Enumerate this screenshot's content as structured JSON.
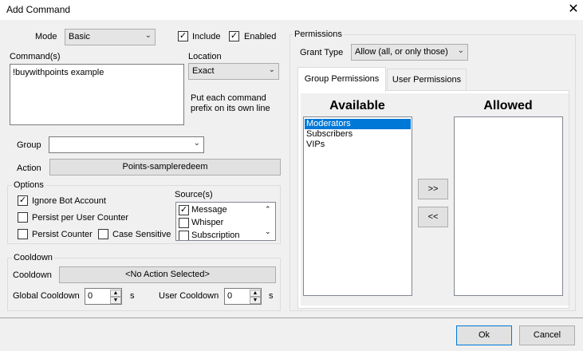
{
  "window": {
    "title": "Add Command",
    "close": "✕"
  },
  "mode": {
    "label": "Mode",
    "value": "Basic"
  },
  "include": {
    "label": "Include",
    "checked": true
  },
  "enabled": {
    "label": "Enabled",
    "checked": true
  },
  "commands": {
    "label": "Command(s)",
    "value": "!buywithpoints example"
  },
  "location": {
    "label": "Location",
    "value": "Exact",
    "hint_line1": "Put each command",
    "hint_line2": "prefix on its own line"
  },
  "group": {
    "label": "Group",
    "value": ""
  },
  "action": {
    "label": "Action",
    "value": "Points-sampleredeem"
  },
  "options": {
    "label": "Options",
    "ignore_bot": {
      "label": "Ignore Bot Account",
      "checked": true
    },
    "persist_user": {
      "label": "Persist per User Counter",
      "checked": false
    },
    "persist_counter": {
      "label": "Persist Counter",
      "checked": false
    },
    "case_sensitive": {
      "label": "Case Sensitive",
      "checked": false
    },
    "sources": {
      "label": "Source(s)",
      "items": [
        {
          "label": "Message",
          "checked": true
        },
        {
          "label": "Whisper",
          "checked": false
        },
        {
          "label": "Subscription",
          "checked": false
        }
      ]
    }
  },
  "cooldown": {
    "group_label": "Cooldown",
    "label": "Cooldown",
    "value": "<No Action Selected>",
    "global_label": "Global Cooldown",
    "global_value": "0",
    "global_unit": "s",
    "user_label": "User Cooldown",
    "user_value": "0",
    "user_unit": "s"
  },
  "permissions": {
    "label": "Permissions",
    "grant_type_label": "Grant Type",
    "grant_type_value": "Allow (all, or only those)",
    "tabs": [
      "Group Permissions",
      "User Permissions"
    ],
    "available_label": "Available",
    "allowed_label": "Allowed",
    "available_items": [
      "Moderators",
      "Subscribers",
      "VIPs"
    ],
    "add_button": ">>",
    "remove_button": "<<"
  },
  "footer": {
    "ok": "Ok",
    "cancel": "Cancel"
  }
}
